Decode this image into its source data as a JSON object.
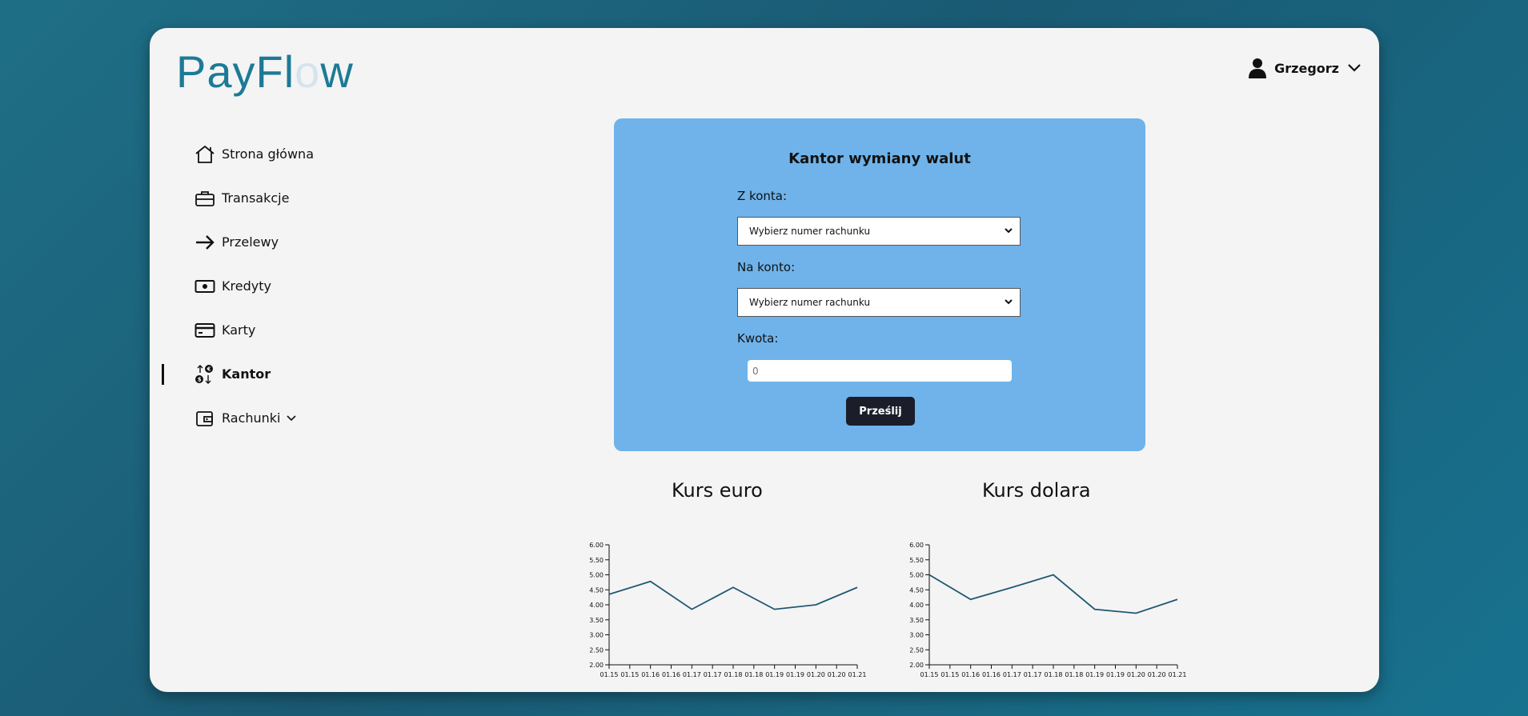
{
  "brand": {
    "logo_text_a": "PayFl",
    "logo_text_o": "o",
    "logo_text_b": "w"
  },
  "user": {
    "name": "Grzegorz"
  },
  "nav": {
    "items": [
      {
        "label": "Strona główna",
        "icon": "home-icon"
      },
      {
        "label": "Transakcje",
        "icon": "briefcase-icon"
      },
      {
        "label": "Przelewy",
        "icon": "arrow-right-icon"
      },
      {
        "label": "Kredyty",
        "icon": "banknote-icon"
      },
      {
        "label": "Karty",
        "icon": "credit-card-icon"
      },
      {
        "label": "Kantor",
        "icon": "currency-exchange-icon",
        "active": true
      },
      {
        "label": "Rachunki",
        "icon": "wallet-icon"
      }
    ]
  },
  "exchange": {
    "title": "Kantor wymiany walut",
    "from_label": "Z konta:",
    "from_value": "Wybierz numer rachunku",
    "to_label": "Na konto:",
    "to_value": "Wybierz numer rachunku",
    "amount_label": "Kwota:",
    "amount_placeholder": "0",
    "submit_label": "Prześlij"
  },
  "colors": {
    "panel": "#6fb3ea",
    "line": "#1f5873",
    "accent": "#1d7a96",
    "button": "#1c1d2b"
  },
  "chart_data": [
    {
      "type": "line",
      "title": "Kurs euro",
      "x": [
        "01.15",
        "01.15",
        "01.16",
        "01.16",
        "01.17",
        "01.17",
        "01.18",
        "01.18",
        "01.19",
        "01.19",
        "01.20",
        "01.20",
        "01.21"
      ],
      "points_x": [
        0,
        2,
        4,
        6,
        8,
        10,
        12
      ],
      "values": [
        4.35,
        4.78,
        3.85,
        4.58,
        3.85,
        4.0,
        4.58
      ],
      "yticks": [
        "2.00",
        "2.50",
        "3.00",
        "3.50",
        "4.00",
        "4.50",
        "5.00",
        "5.50",
        "6.00"
      ],
      "ylim": [
        2,
        6
      ]
    },
    {
      "type": "line",
      "title": "Kurs dolara",
      "x": [
        "01.15",
        "01.15",
        "01.16",
        "01.16",
        "01.17",
        "01.17",
        "01.18",
        "01.18",
        "01.19",
        "01.19",
        "01.20",
        "01.20",
        "01.21"
      ],
      "points_x": [
        0,
        2,
        4,
        6,
        8,
        10,
        12
      ],
      "values": [
        5.0,
        4.18,
        4.58,
        5.0,
        3.85,
        3.72,
        4.18
      ],
      "yticks": [
        "2.00",
        "2.50",
        "3.00",
        "3.50",
        "4.00",
        "4.50",
        "5.00",
        "5.50",
        "6.00"
      ],
      "ylim": [
        2,
        6
      ]
    }
  ]
}
